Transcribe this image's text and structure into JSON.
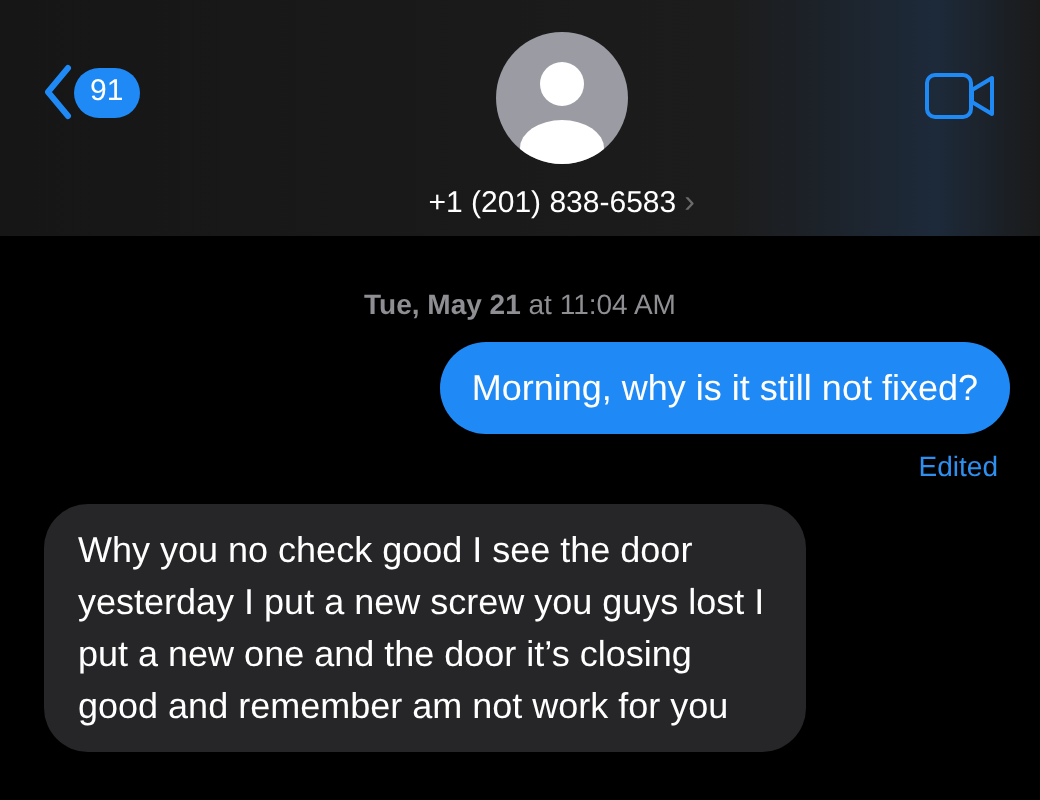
{
  "header": {
    "back_count": "91",
    "contact": "+1 (201) 838-6583",
    "chevron": "›"
  },
  "timestamp": {
    "day": "Tue, May 21",
    "rest": " at 11:04 AM"
  },
  "messages": [
    {
      "kind": "sent",
      "text": "Morning, why is it still not fixed?",
      "note": "Edited"
    },
    {
      "kind": "received",
      "text": "Why you no check good I see the door yesterday I put a new screw you guys lost I put a new one and the door it’s closing good and remember am not work for you"
    }
  ]
}
